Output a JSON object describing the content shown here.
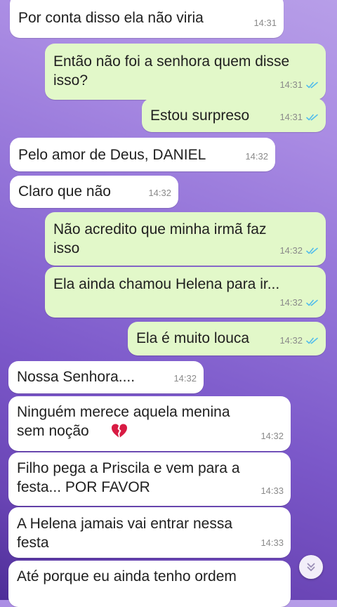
{
  "colors": {
    "incoming_bubble": "#ffffff",
    "outgoing_bubble": "#e2f8c9",
    "read_ticks": "#53bdeb"
  },
  "messages": [
    {
      "direction": "in",
      "text": "Por conta disso ela não viria",
      "time": "14:31"
    },
    {
      "direction": "out",
      "text": "Então não foi a senhora quem disse\nisso?",
      "time": "14:31",
      "status": "read"
    },
    {
      "direction": "out",
      "text": "Estou surpreso",
      "time": "14:31",
      "status": "read"
    },
    {
      "direction": "in",
      "text": "Pelo amor de Deus, DANIEL",
      "time": "14:32"
    },
    {
      "direction": "in",
      "text": "Claro que não",
      "time": "14:32"
    },
    {
      "direction": "out",
      "text": "Não acredito que minha irmã faz\nisso",
      "time": "14:32",
      "status": "read"
    },
    {
      "direction": "out",
      "text": "Ela ainda chamou Helena para ir...",
      "time": "14:32",
      "status": "read"
    },
    {
      "direction": "out",
      "text": "Ela é muito louca",
      "time": "14:32",
      "status": "read"
    },
    {
      "direction": "in",
      "text": "Nossa Senhora....",
      "time": "14:32"
    },
    {
      "direction": "in",
      "text": "Ninguém merece aquela menina\nsem noção",
      "time": "14:32",
      "emoji": "broken-heart-icon"
    },
    {
      "direction": "in",
      "text": "Filho pega a Priscila e vem para a\nfesta... POR FAVOR",
      "time": "14:33"
    },
    {
      "direction": "in",
      "text": "A Helena jamais vai entrar nessa\nfesta",
      "time": "14:33"
    },
    {
      "direction": "in",
      "text": "Até porque eu ainda tenho ordem",
      "time": ""
    }
  ],
  "scroll_button": {
    "icon": "double-chevron-down-icon"
  }
}
